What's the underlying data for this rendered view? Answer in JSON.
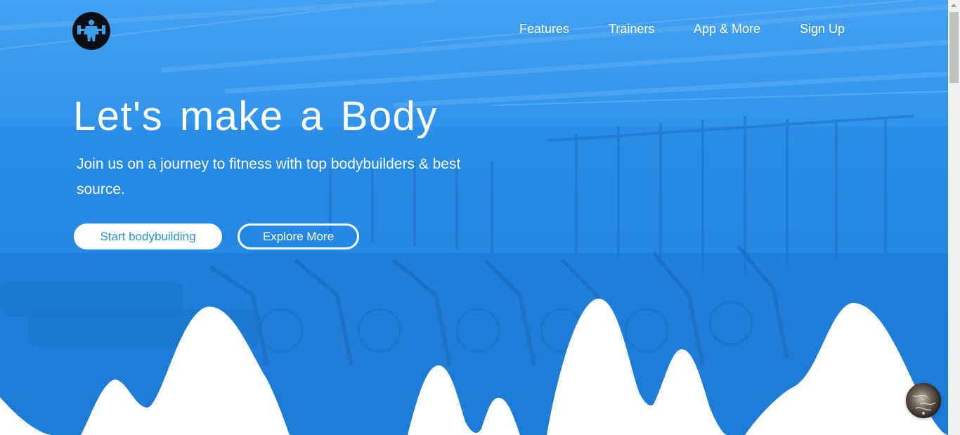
{
  "header": {
    "logo_icon": "bodybuilder-logo-icon",
    "nav": [
      {
        "label": "Features"
      },
      {
        "label": "Trainers"
      },
      {
        "label": "App & More"
      },
      {
        "label": "Sign Up"
      }
    ]
  },
  "hero": {
    "title": "Let's make a Body",
    "subtitle": "Join us on a journey to fitness with top bodybuilders & best source.",
    "primary_button": "Start bodybuilding",
    "secondary_button": "Explore More"
  },
  "widgets": {
    "floating_avatar_icon": "avatar-icon"
  },
  "colors": {
    "brand_blue": "#2e8ee6",
    "primary_button_text": "#2b91d8",
    "text_light": "#ffffff"
  }
}
